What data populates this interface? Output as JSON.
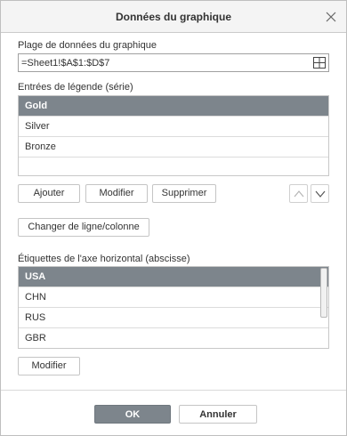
{
  "dialog": {
    "title": "Données du graphique",
    "close_icon": "close-icon"
  },
  "range": {
    "label": "Plage de données du graphique",
    "value": "=Sheet1!$A$1:$D$7",
    "select_icon": "grid-icon"
  },
  "series": {
    "label": "Entrées de légende (série)",
    "items": [
      "Gold",
      "Silver",
      "Bronze",
      ""
    ],
    "selected_index": 0,
    "add_label": "Ajouter",
    "edit_label": "Modifier",
    "delete_label": "Supprimer",
    "up_icon": "chevron-up-icon",
    "down_icon": "chevron-down-icon"
  },
  "switch_label": "Changer de ligne/colonne",
  "categories": {
    "label": "Étiquettes de l'axe horizontal (abscisse)",
    "items": [
      "USA",
      "CHN",
      "RUS",
      "GBR"
    ],
    "selected_index": 0,
    "edit_label": "Modifier"
  },
  "footer": {
    "ok_label": "OK",
    "cancel_label": "Annuler"
  },
  "colors": {
    "selected_row": "#7d858c",
    "primary_button": "#7d858c",
    "title_bar": "#f4f4f4"
  }
}
